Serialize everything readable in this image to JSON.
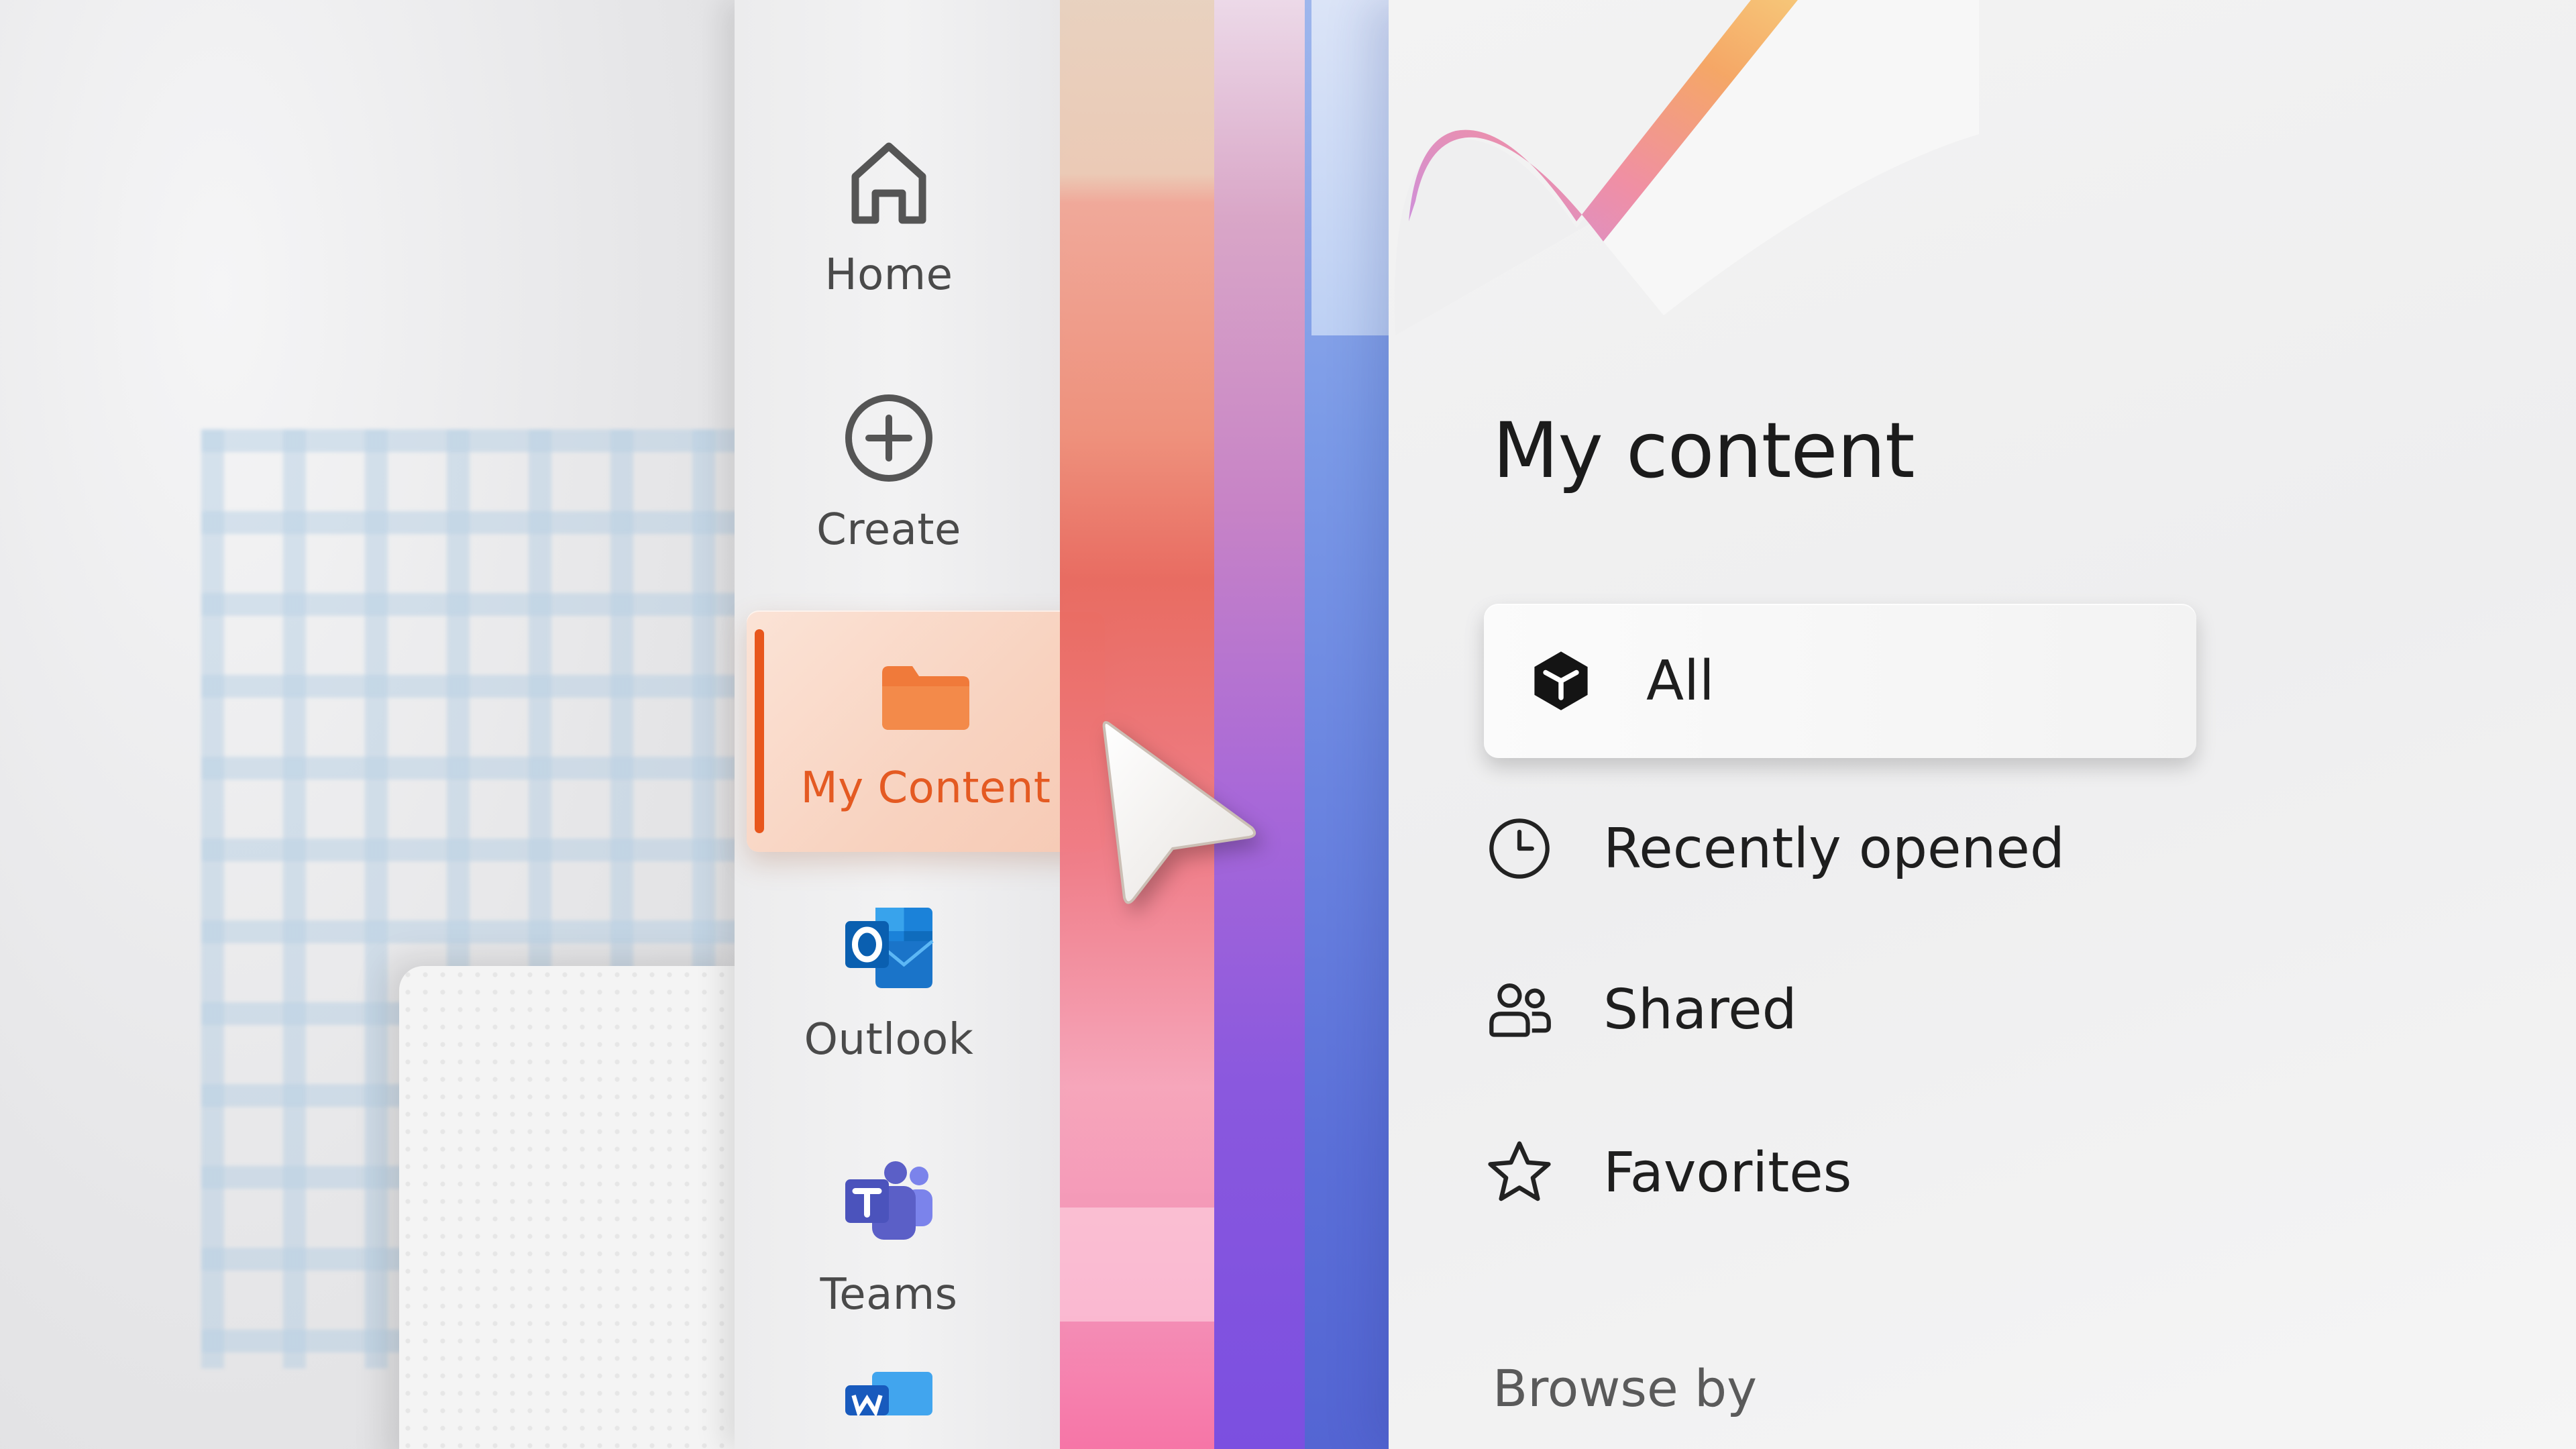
{
  "nav": {
    "items": [
      {
        "label": "Home",
        "icon": "home-icon"
      },
      {
        "label": "Create",
        "icon": "plus-circle-icon"
      },
      {
        "label": "My Content",
        "icon": "folder-icon",
        "active": true
      },
      {
        "label": "Outlook",
        "icon": "outlook-icon"
      },
      {
        "label": "Teams",
        "icon": "teams-icon"
      },
      {
        "label": "",
        "icon": "word-icon"
      }
    ]
  },
  "content": {
    "title": "My content",
    "filters": [
      {
        "label": "All",
        "icon": "cube-icon",
        "selected": true
      },
      {
        "label": "Recently opened",
        "icon": "clock-icon"
      },
      {
        "label": "Shared",
        "icon": "people-icon"
      },
      {
        "label": "Favorites",
        "icon": "star-icon"
      }
    ],
    "browse_by": "Browse by"
  },
  "colors": {
    "accent": "#e8561c",
    "nav_active_bg": "#f8d2bf",
    "text_primary": "#1b1b1b",
    "text_secondary": "#4a4a4a"
  }
}
